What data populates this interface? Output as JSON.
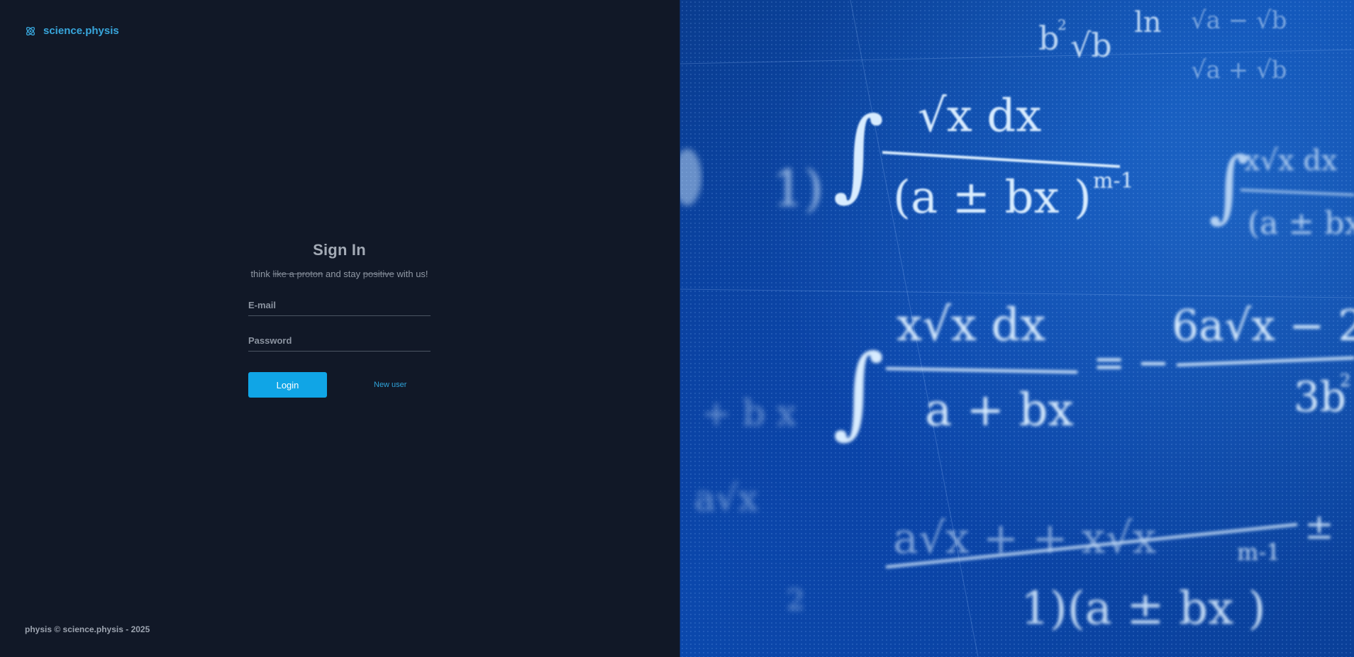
{
  "brand": {
    "icon": "atom-icon",
    "name": "science.physis"
  },
  "signin": {
    "title": "Sign In",
    "tagline_think": "think",
    "tagline_strike1": "like a proton",
    "tagline_mid": "and stay",
    "tagline_strike2": "positive",
    "tagline_end": "with us!"
  },
  "form": {
    "email_placeholder": "E-mail",
    "password_placeholder": "Password",
    "login_label": "Login",
    "new_user_label": "New user"
  },
  "footer": {
    "text": "physis © science.physis - 2025"
  },
  "colors": {
    "background": "#111827",
    "accent": "#10a5e6",
    "math_panel": "#0c4fb4"
  }
}
